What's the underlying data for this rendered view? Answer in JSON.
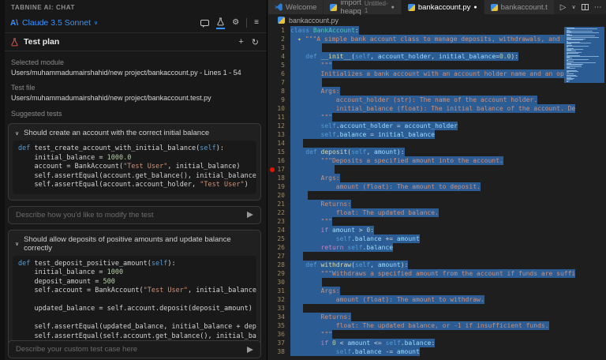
{
  "colors": {
    "accent": "#3794ff",
    "selection": "#2b5c94",
    "breakpoint": "#e51400",
    "flask_red": "#d9534a"
  },
  "panel": {
    "title": "TABNINE AI: CHAT",
    "model": {
      "name": "Claude 3.5 Sonnet"
    },
    "section_title": "Test plan",
    "selected_module": {
      "label": "Selected module",
      "value": "Users/muhammadumairshahid/new project/bankaccount.py  -  Lines 1 - 54"
    },
    "test_file": {
      "label": "Test file",
      "value": "Users/muhammadumairshahid/new project/bankaccount.test.py"
    },
    "suggested_tests_label": "Suggested tests",
    "tests": [
      {
        "title": "Should create an account with the correct initial balance",
        "code": [
          [
            [
              "kw",
              "def"
            ],
            [
              "pl",
              " test_create_account_with_initial_balance("
            ],
            [
              "self",
              "self"
            ],
            [
              "pl",
              "):"
            ]
          ],
          [
            [
              "pl",
              "    initial_balance "
            ],
            [
              "op",
              "="
            ],
            [
              "pl",
              " "
            ],
            [
              "num",
              "1000.0"
            ]
          ],
          [
            [
              "pl",
              "    account "
            ],
            [
              "op",
              "="
            ],
            [
              "pl",
              " BankAccount("
            ],
            [
              "str",
              "\"Test User\""
            ],
            [
              "pl",
              ", initial_balance)"
            ]
          ],
          [
            [
              "pl",
              "    self.assertEqual(account.get_balance(), initial_balance)"
            ]
          ],
          [
            [
              "pl",
              "    self.assertEqual(account.account_holder, "
            ],
            [
              "str",
              "\"Test User\""
            ],
            [
              "pl",
              ")"
            ]
          ]
        ],
        "input_placeholder": "Describe how you'd like to modify the test"
      },
      {
        "title": "Should allow deposits of positive amounts and update balance correctly",
        "code": [
          [
            [
              "kw",
              "def"
            ],
            [
              "pl",
              " test_deposit_positive_amount("
            ],
            [
              "self",
              "self"
            ],
            [
              "pl",
              "):"
            ]
          ],
          [
            [
              "pl",
              "    initial_balance "
            ],
            [
              "op",
              "="
            ],
            [
              "pl",
              " "
            ],
            [
              "num",
              "1000"
            ]
          ],
          [
            [
              "pl",
              "    deposit_amount "
            ],
            [
              "op",
              "="
            ],
            [
              "pl",
              " "
            ],
            [
              "num",
              "500"
            ]
          ],
          [
            [
              "pl",
              "    self.account "
            ],
            [
              "op",
              "="
            ],
            [
              "pl",
              " BankAccount("
            ],
            [
              "str",
              "\"Test User\""
            ],
            [
              "pl",
              ", initial_balance)"
            ]
          ],
          [],
          [
            [
              "pl",
              "    updated_balance "
            ],
            [
              "op",
              "="
            ],
            [
              "pl",
              " self.account.deposit(deposit_amount)"
            ]
          ],
          [],
          [
            [
              "pl",
              "    self.assertEqual(updated_balance, initial_balance + deposit"
            ]
          ],
          [
            [
              "pl",
              "    self.assertEqual(self.account.get_balance(), initial_balanc"
            ]
          ]
        ]
      }
    ],
    "bottom_input_placeholder": "Describe your custom test case here"
  },
  "editor": {
    "tabs": [
      {
        "label": "Welcome",
        "icon": "vscode",
        "active": false,
        "dirty": false
      },
      {
        "label": "import heapq",
        "sublabel": "Untitled-1",
        "icon": "python",
        "active": false,
        "dirty": true
      },
      {
        "label": "bankaccount.py",
        "icon": "python",
        "active": true,
        "dirty": true
      },
      {
        "label": "bankaccount.t",
        "icon": "python",
        "active": false,
        "dirty": false
      }
    ],
    "dirty_dot": "●",
    "actions": {
      "run": "▷",
      "run_chevron": "∨",
      "more": "⋯"
    },
    "breadcrumb": "bankaccount.py",
    "lines": [
      {
        "n": 1,
        "t": [
          [
            "kw",
            "class"
          ],
          [
            "pl",
            " "
          ],
          [
            "cls",
            "BankAccount"
          ],
          [
            "pl",
            ":"
          ]
        ]
      },
      {
        "n": 2,
        "sp": true,
        "t": [
          [
            "doc",
            "\"\"\"A simple bank account class to manage deposits, withdrawals, and bal"
          ]
        ]
      },
      {
        "n": 3,
        "blk": 40
      },
      {
        "n": 4,
        "t": [
          [
            "pl",
            "    "
          ],
          [
            "kw",
            "def"
          ],
          [
            "pl",
            " "
          ],
          [
            "fn",
            "__init__"
          ],
          [
            "pl",
            "("
          ],
          [
            "self",
            "self"
          ],
          [
            "pl",
            ", "
          ],
          [
            "var",
            "account_holder"
          ],
          [
            "pl",
            ", "
          ],
          [
            "var",
            "initial_balance"
          ],
          [
            "op",
            "="
          ],
          [
            "num",
            "0.0"
          ],
          [
            "pl",
            "):"
          ]
        ]
      },
      {
        "n": 5,
        "t": [
          [
            "pl",
            "        "
          ],
          [
            "doc",
            "\"\"\""
          ]
        ]
      },
      {
        "n": 6,
        "t": [
          [
            "pl",
            "        "
          ],
          [
            "doc",
            "Initializes a bank account with an account holder name and an optio"
          ]
        ]
      },
      {
        "n": 7,
        "blk": 40
      },
      {
        "n": 8,
        "t": [
          [
            "pl",
            "        "
          ],
          [
            "doc",
            "Args:"
          ]
        ]
      },
      {
        "n": 9,
        "t": [
          [
            "pl",
            "            "
          ],
          [
            "doc",
            "account_holder (str): The name of the account holder."
          ]
        ]
      },
      {
        "n": 10,
        "t": [
          [
            "pl",
            "            "
          ],
          [
            "doc",
            "initial_balance (float): The initial balance of the account. De"
          ]
        ]
      },
      {
        "n": 11,
        "t": [
          [
            "pl",
            "        "
          ],
          [
            "doc",
            "\"\"\""
          ]
        ]
      },
      {
        "n": 12,
        "t": [
          [
            "pl",
            "        "
          ],
          [
            "self",
            "self"
          ],
          [
            "pl",
            "."
          ],
          [
            "var",
            "account_holder"
          ],
          [
            "pl",
            " "
          ],
          [
            "op",
            "="
          ],
          [
            "pl",
            " "
          ],
          [
            "var",
            "account_holder"
          ]
        ]
      },
      {
        "n": 13,
        "t": [
          [
            "pl",
            "        "
          ],
          [
            "self",
            "self"
          ],
          [
            "pl",
            "."
          ],
          [
            "var",
            "balance"
          ],
          [
            "pl",
            " "
          ],
          [
            "op",
            "="
          ],
          [
            "pl",
            " "
          ],
          [
            "var",
            "initial_balance"
          ]
        ]
      },
      {
        "n": 14,
        "blk": 16
      },
      {
        "n": 15,
        "t": [
          [
            "pl",
            "    "
          ],
          [
            "kw",
            "def"
          ],
          [
            "pl",
            " "
          ],
          [
            "fn",
            "deposit"
          ],
          [
            "pl",
            "("
          ],
          [
            "self",
            "self"
          ],
          [
            "pl",
            ", "
          ],
          [
            "var",
            "amount"
          ],
          [
            "pl",
            "):"
          ]
        ]
      },
      {
        "n": 16,
        "t": [
          [
            "pl",
            "        "
          ],
          [
            "doc",
            "\"\"\"Deposits a specified amount into the account."
          ]
        ]
      },
      {
        "n": 17,
        "blk": 56,
        "bp": true
      },
      {
        "n": 18,
        "t": [
          [
            "pl",
            "        "
          ],
          [
            "doc",
            "Args:"
          ]
        ]
      },
      {
        "n": 19,
        "t": [
          [
            "pl",
            "            "
          ],
          [
            "doc",
            "amount (float): The amount to deposit."
          ]
        ]
      },
      {
        "n": 20,
        "blk": 22
      },
      {
        "n": 21,
        "t": [
          [
            "pl",
            "        "
          ],
          [
            "doc",
            "Returns:"
          ]
        ]
      },
      {
        "n": 22,
        "t": [
          [
            "pl",
            "            "
          ],
          [
            "doc",
            "float: The updated balance."
          ]
        ]
      },
      {
        "n": 23,
        "t": [
          [
            "pl",
            "        "
          ],
          [
            "doc",
            "\"\"\""
          ]
        ]
      },
      {
        "n": 24,
        "t": [
          [
            "pl",
            "        "
          ],
          [
            "ctl",
            "if"
          ],
          [
            "pl",
            " "
          ],
          [
            "var",
            "amount"
          ],
          [
            "pl",
            " "
          ],
          [
            "op",
            ">"
          ],
          [
            "pl",
            " "
          ],
          [
            "num",
            "0"
          ],
          [
            "pl",
            ":"
          ]
        ]
      },
      {
        "n": 25,
        "t": [
          [
            "pl",
            "            "
          ],
          [
            "self",
            "self"
          ],
          [
            "pl",
            "."
          ],
          [
            "var",
            "balance"
          ],
          [
            "pl",
            " "
          ],
          [
            "op",
            "+="
          ],
          [
            "pl",
            " "
          ],
          [
            "var",
            "amount"
          ]
        ]
      },
      {
        "n": 26,
        "t": [
          [
            "pl",
            "        "
          ],
          [
            "ctl",
            "return"
          ],
          [
            "pl",
            " "
          ],
          [
            "self",
            "self"
          ],
          [
            "pl",
            "."
          ],
          [
            "var",
            "balance"
          ]
        ]
      },
      {
        "n": 27,
        "blk": 16
      },
      {
        "n": 28,
        "t": [
          [
            "pl",
            "    "
          ],
          [
            "kw",
            "def"
          ],
          [
            "pl",
            " "
          ],
          [
            "fn",
            "withdraw"
          ],
          [
            "pl",
            "("
          ],
          [
            "self",
            "self"
          ],
          [
            "pl",
            ", "
          ],
          [
            "var",
            "amount"
          ],
          [
            "pl",
            "):"
          ]
        ]
      },
      {
        "n": 29,
        "t": [
          [
            "pl",
            "        "
          ],
          [
            "doc",
            "\"\"\"Withdraws a specified amount from the account if funds are suffi"
          ]
        ]
      },
      {
        "n": 30,
        "blk": 40
      },
      {
        "n": 31,
        "t": [
          [
            "pl",
            "        "
          ],
          [
            "doc",
            "Args:"
          ]
        ]
      },
      {
        "n": 32,
        "t": [
          [
            "pl",
            "            "
          ],
          [
            "doc",
            "amount (float): The amount to withdraw."
          ]
        ]
      },
      {
        "n": 33,
        "blk": 16
      },
      {
        "n": 34,
        "t": [
          [
            "pl",
            "        "
          ],
          [
            "doc",
            "Returns:"
          ]
        ]
      },
      {
        "n": 35,
        "t": [
          [
            "pl",
            "            "
          ],
          [
            "doc",
            "float: The updated balance, or -1 if insufficient funds."
          ]
        ]
      },
      {
        "n": 36,
        "t": [
          [
            "pl",
            "        "
          ],
          [
            "doc",
            "\"\"\""
          ]
        ]
      },
      {
        "n": 37,
        "t": [
          [
            "pl",
            "        "
          ],
          [
            "ctl",
            "if"
          ],
          [
            "pl",
            " "
          ],
          [
            "num",
            "0"
          ],
          [
            "pl",
            " "
          ],
          [
            "op",
            "<"
          ],
          [
            "pl",
            " "
          ],
          [
            "var",
            "amount"
          ],
          [
            "pl",
            " "
          ],
          [
            "op",
            "<="
          ],
          [
            "pl",
            " "
          ],
          [
            "self",
            "self"
          ],
          [
            "pl",
            "."
          ],
          [
            "var",
            "balance"
          ],
          [
            "pl",
            ":"
          ]
        ]
      },
      {
        "n": 38,
        "t": [
          [
            "pl",
            "            "
          ],
          [
            "self",
            "self"
          ],
          [
            "pl",
            "."
          ],
          [
            "var",
            "balance"
          ],
          [
            "pl",
            " "
          ],
          [
            "op",
            "-="
          ],
          [
            "pl",
            " "
          ],
          [
            "var",
            "amount"
          ]
        ]
      }
    ],
    "minimap_extra": [
      34,
      8,
      20,
      0,
      24,
      28,
      6,
      16,
      0,
      22,
      26,
      10,
      18,
      14,
      8,
      4
    ]
  }
}
